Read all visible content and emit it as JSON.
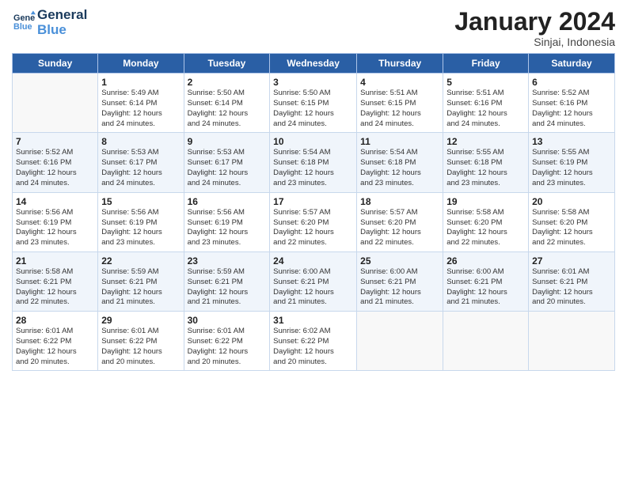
{
  "logo": {
    "line1": "General",
    "line2": "Blue"
  },
  "title": "January 2024",
  "location": "Sinjai, Indonesia",
  "weekdays": [
    "Sunday",
    "Monday",
    "Tuesday",
    "Wednesday",
    "Thursday",
    "Friday",
    "Saturday"
  ],
  "weeks": [
    [
      {
        "day": "",
        "detail": ""
      },
      {
        "day": "1",
        "detail": "Sunrise: 5:49 AM\nSunset: 6:14 PM\nDaylight: 12 hours\nand 24 minutes."
      },
      {
        "day": "2",
        "detail": "Sunrise: 5:50 AM\nSunset: 6:14 PM\nDaylight: 12 hours\nand 24 minutes."
      },
      {
        "day": "3",
        "detail": "Sunrise: 5:50 AM\nSunset: 6:15 PM\nDaylight: 12 hours\nand 24 minutes."
      },
      {
        "day": "4",
        "detail": "Sunrise: 5:51 AM\nSunset: 6:15 PM\nDaylight: 12 hours\nand 24 minutes."
      },
      {
        "day": "5",
        "detail": "Sunrise: 5:51 AM\nSunset: 6:16 PM\nDaylight: 12 hours\nand 24 minutes."
      },
      {
        "day": "6",
        "detail": "Sunrise: 5:52 AM\nSunset: 6:16 PM\nDaylight: 12 hours\nand 24 minutes."
      }
    ],
    [
      {
        "day": "7",
        "detail": "Sunrise: 5:52 AM\nSunset: 6:16 PM\nDaylight: 12 hours\nand 24 minutes."
      },
      {
        "day": "8",
        "detail": "Sunrise: 5:53 AM\nSunset: 6:17 PM\nDaylight: 12 hours\nand 24 minutes."
      },
      {
        "day": "9",
        "detail": "Sunrise: 5:53 AM\nSunset: 6:17 PM\nDaylight: 12 hours\nand 24 minutes."
      },
      {
        "day": "10",
        "detail": "Sunrise: 5:54 AM\nSunset: 6:18 PM\nDaylight: 12 hours\nand 23 minutes."
      },
      {
        "day": "11",
        "detail": "Sunrise: 5:54 AM\nSunset: 6:18 PM\nDaylight: 12 hours\nand 23 minutes."
      },
      {
        "day": "12",
        "detail": "Sunrise: 5:55 AM\nSunset: 6:18 PM\nDaylight: 12 hours\nand 23 minutes."
      },
      {
        "day": "13",
        "detail": "Sunrise: 5:55 AM\nSunset: 6:19 PM\nDaylight: 12 hours\nand 23 minutes."
      }
    ],
    [
      {
        "day": "14",
        "detail": "Sunrise: 5:56 AM\nSunset: 6:19 PM\nDaylight: 12 hours\nand 23 minutes."
      },
      {
        "day": "15",
        "detail": "Sunrise: 5:56 AM\nSunset: 6:19 PM\nDaylight: 12 hours\nand 23 minutes."
      },
      {
        "day": "16",
        "detail": "Sunrise: 5:56 AM\nSunset: 6:19 PM\nDaylight: 12 hours\nand 23 minutes."
      },
      {
        "day": "17",
        "detail": "Sunrise: 5:57 AM\nSunset: 6:20 PM\nDaylight: 12 hours\nand 22 minutes."
      },
      {
        "day": "18",
        "detail": "Sunrise: 5:57 AM\nSunset: 6:20 PM\nDaylight: 12 hours\nand 22 minutes."
      },
      {
        "day": "19",
        "detail": "Sunrise: 5:58 AM\nSunset: 6:20 PM\nDaylight: 12 hours\nand 22 minutes."
      },
      {
        "day": "20",
        "detail": "Sunrise: 5:58 AM\nSunset: 6:20 PM\nDaylight: 12 hours\nand 22 minutes."
      }
    ],
    [
      {
        "day": "21",
        "detail": "Sunrise: 5:58 AM\nSunset: 6:21 PM\nDaylight: 12 hours\nand 22 minutes."
      },
      {
        "day": "22",
        "detail": "Sunrise: 5:59 AM\nSunset: 6:21 PM\nDaylight: 12 hours\nand 21 minutes."
      },
      {
        "day": "23",
        "detail": "Sunrise: 5:59 AM\nSunset: 6:21 PM\nDaylight: 12 hours\nand 21 minutes."
      },
      {
        "day": "24",
        "detail": "Sunrise: 6:00 AM\nSunset: 6:21 PM\nDaylight: 12 hours\nand 21 minutes."
      },
      {
        "day": "25",
        "detail": "Sunrise: 6:00 AM\nSunset: 6:21 PM\nDaylight: 12 hours\nand 21 minutes."
      },
      {
        "day": "26",
        "detail": "Sunrise: 6:00 AM\nSunset: 6:21 PM\nDaylight: 12 hours\nand 21 minutes."
      },
      {
        "day": "27",
        "detail": "Sunrise: 6:01 AM\nSunset: 6:21 PM\nDaylight: 12 hours\nand 20 minutes."
      }
    ],
    [
      {
        "day": "28",
        "detail": "Sunrise: 6:01 AM\nSunset: 6:22 PM\nDaylight: 12 hours\nand 20 minutes."
      },
      {
        "day": "29",
        "detail": "Sunrise: 6:01 AM\nSunset: 6:22 PM\nDaylight: 12 hours\nand 20 minutes."
      },
      {
        "day": "30",
        "detail": "Sunrise: 6:01 AM\nSunset: 6:22 PM\nDaylight: 12 hours\nand 20 minutes."
      },
      {
        "day": "31",
        "detail": "Sunrise: 6:02 AM\nSunset: 6:22 PM\nDaylight: 12 hours\nand 20 minutes."
      },
      {
        "day": "",
        "detail": ""
      },
      {
        "day": "",
        "detail": ""
      },
      {
        "day": "",
        "detail": ""
      }
    ]
  ]
}
